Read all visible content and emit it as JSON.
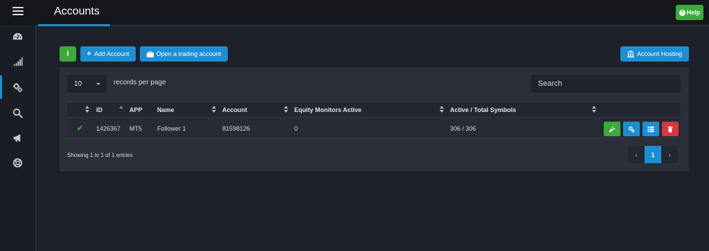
{
  "header": {
    "title": "Accounts",
    "help_label": "Help"
  },
  "sidebar": {
    "items": [
      {
        "icon": "dashboard-icon"
      },
      {
        "icon": "signal-bars-icon"
      },
      {
        "icon": "gears-icon",
        "active": true
      },
      {
        "icon": "search-icon"
      },
      {
        "icon": "megaphone-icon"
      },
      {
        "icon": "life-ring-icon"
      }
    ]
  },
  "toolbar": {
    "info_label": "i",
    "add_account_label": "Add Account",
    "open_trading_label": "Open a trading account",
    "account_hosting_label": "Account Hosting"
  },
  "table_controls": {
    "page_length": "10",
    "page_length_label": "records per page",
    "search_placeholder": "Search"
  },
  "table": {
    "columns": [
      "",
      "ID",
      "APP",
      "Name",
      "Account",
      "Equity Monitors Active",
      "Active / Total Symbols",
      ""
    ],
    "rows": [
      {
        "status": "✔",
        "id": "1426367",
        "app": "MT5",
        "name": "Follower 1",
        "account": "81598126",
        "equity_monitors_active": "0",
        "active_total_symbols": "306 / 306"
      }
    ]
  },
  "footer": {
    "info": "Showing 1 to 1 of 1 entries",
    "prev_label": "‹",
    "current_page": "1",
    "next_label": "›"
  },
  "colors": {
    "background": "#1e212a",
    "panel": "#2a2f3a",
    "primary": "#1c8ed3",
    "success": "#3cab3c",
    "danger": "#d9363e"
  }
}
